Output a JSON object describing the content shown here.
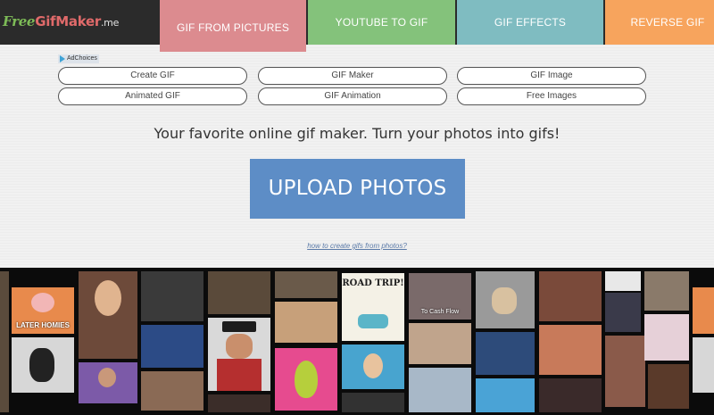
{
  "header": {
    "logo": {
      "free": "Free",
      "gif": "GifMaker",
      "suffix": ".me"
    },
    "tabs": [
      {
        "label": "GIF FROM PICTURES",
        "color": "#dc8b8f"
      },
      {
        "label": "YOUTUBE TO GIF",
        "color": "#84c27b"
      },
      {
        "label": "GIF EFFECTS",
        "color": "#7fbcc1"
      },
      {
        "label": "REVERSE GIF",
        "color": "#f7a45d"
      }
    ]
  },
  "ad": {
    "adchoices": "AdChoices",
    "links": [
      "Create GIF",
      "GIF Maker",
      "GIF Image",
      "Animated GIF",
      "GIF Animation",
      "Free Images"
    ]
  },
  "main": {
    "tagline": "Your favorite online gif maker. Turn your photos into gifs!",
    "upload_label": "UPLOAD PHOTOS",
    "help_link": "how to create gifs from photos?"
  },
  "gallery": {
    "captions": {
      "later_homies": "LATER HOMIES",
      "road_trip": "ROAD TRIP!",
      "to_cash_flow": "To Cash Flow"
    }
  },
  "colors": {
    "header_bg": "#2b2b2b",
    "upload_button": "#5d8dc6",
    "gallery_bg": "#0b0b0b"
  }
}
